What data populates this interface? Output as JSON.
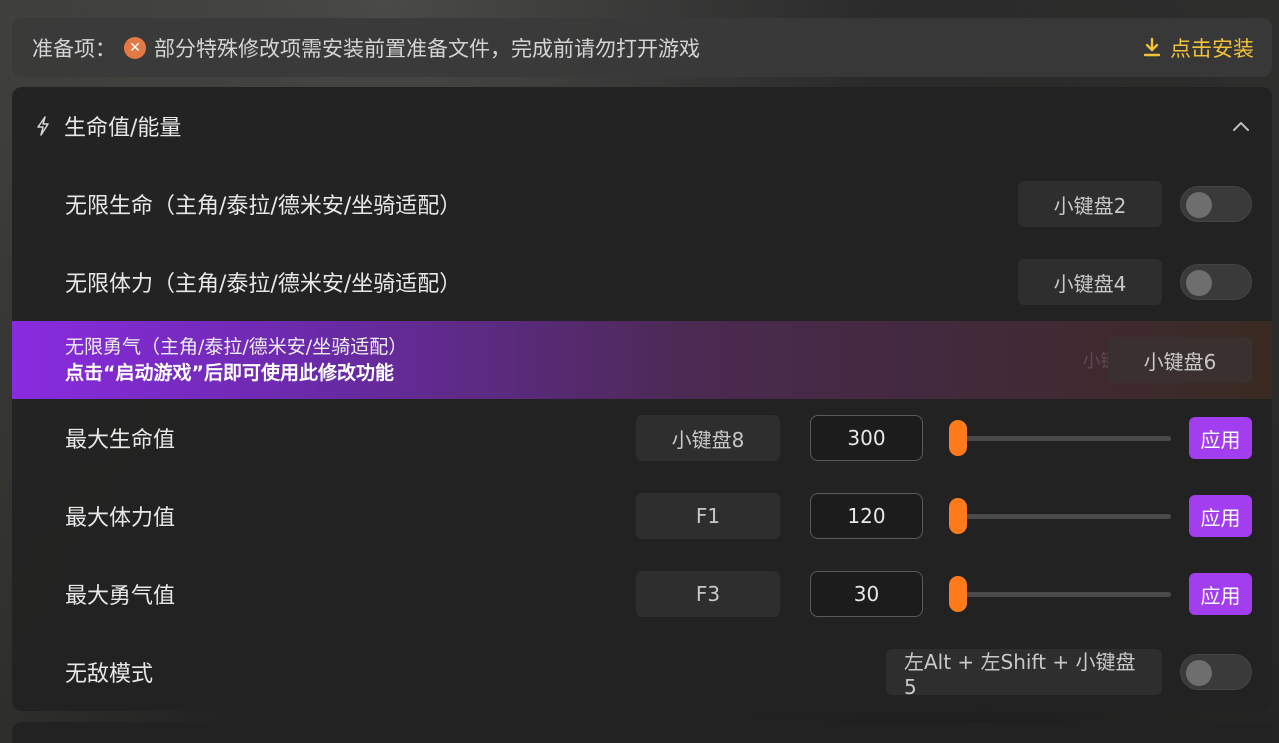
{
  "prep": {
    "label": "准备项：",
    "message": "部分特殊修改项需安装前置准备文件，完成前请勿打开游戏",
    "install_label": "点击安装",
    "accent": "#f0c23a"
  },
  "section": {
    "title": "生命值/能量",
    "icon": "lightning-icon",
    "collapse_icon": "chevron-up-icon"
  },
  "toggle_rows": [
    {
      "label": "无限生命（主角/泰拉/德米安/坐骑适配）",
      "hotkey": "小键盘2",
      "enabled": false
    },
    {
      "label": "无限体力（主角/泰拉/德米安/坐骑适配）",
      "hotkey": "小键盘4",
      "enabled": false
    }
  ],
  "highlight_row": {
    "title": "无限勇气（主角/泰拉/德米安/坐骑适配）",
    "subtitle": "点击“启动游戏”后即可使用此修改功能",
    "ghost_hotkey": "小键盘6",
    "hotkey": "小键盘6"
  },
  "value_rows": [
    {
      "label": "最大生命值",
      "hotkey": "小键盘8",
      "value": "300",
      "slider_fraction": 0.0,
      "apply_label": "应用"
    },
    {
      "label": "最大体力值",
      "hotkey": "F1",
      "value": "120",
      "slider_fraction": 0.0,
      "apply_label": "应用"
    },
    {
      "label": "最大勇气值",
      "hotkey": "F3",
      "value": "30",
      "slider_fraction": 0.0,
      "apply_label": "应用"
    }
  ],
  "god_mode_row": {
    "label": "无敌模式",
    "hotkey": "左Alt + 左Shift + 小键盘5",
    "enabled": false
  },
  "colors": {
    "apply": "#a23ef0",
    "slider": "#ff7a1a",
    "highlight_start": "#8a2be2"
  }
}
